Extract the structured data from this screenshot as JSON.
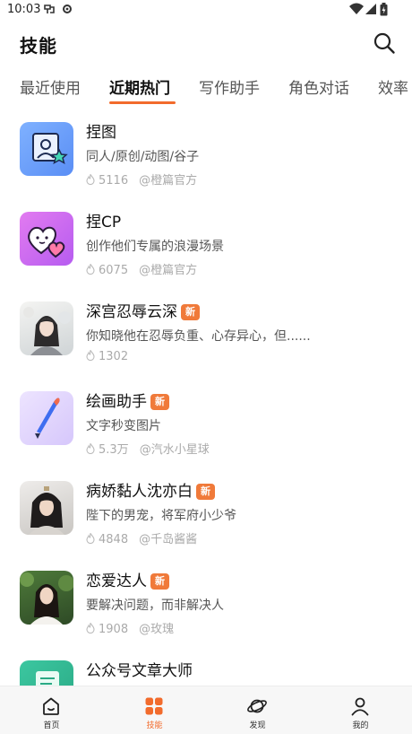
{
  "status_bar": {
    "time": "10:03"
  },
  "header": {
    "title": "技能"
  },
  "tabs": [
    {
      "label": "最近使用",
      "active": false
    },
    {
      "label": "近期热门",
      "active": true
    },
    {
      "label": "写作助手",
      "active": false
    },
    {
      "label": "角色对话",
      "active": false
    },
    {
      "label": "效率",
      "active": false
    }
  ],
  "skills": [
    {
      "name": "捏图",
      "badge": "",
      "desc": "同人/原创/动图/谷子",
      "heat": "5116",
      "author": "@橙篇官方",
      "icon": "photo-edit-icon"
    },
    {
      "name": "捏CP",
      "badge": "",
      "desc": "创作他们专属的浪漫场景",
      "heat": "6075",
      "author": "@橙篇官方",
      "icon": "hearts-icon"
    },
    {
      "name": "深宫忍辱云深",
      "badge": "新",
      "desc": "你知晓他在忍辱负重、心存异心，但......",
      "heat": "1302",
      "author": "",
      "icon": "character-portrait"
    },
    {
      "name": "绘画助手",
      "badge": "新",
      "desc": "文字秒变图片",
      "heat": "5.3万",
      "author": "@汽水小星球",
      "icon": "paint-brush-icon"
    },
    {
      "name": "病娇黏人沈亦白",
      "badge": "新",
      "desc": "陛下的男宠，将军府小少爷",
      "heat": "4848",
      "author": "@千岛酱酱",
      "icon": "character-portrait"
    },
    {
      "name": "恋爱达人",
      "badge": "新",
      "desc": "要解决问题，而非解决人",
      "heat": "1908",
      "author": "@玫瑰",
      "icon": "character-portrait"
    },
    {
      "name": "公众号文章大师",
      "badge": "",
      "desc": "",
      "heat": "",
      "author": "",
      "icon": "article-icon"
    }
  ],
  "bottom_nav": [
    {
      "label": "首页",
      "icon": "home-icon",
      "active": false
    },
    {
      "label": "技能",
      "icon": "grid-icon",
      "active": true
    },
    {
      "label": "发现",
      "icon": "planet-icon",
      "active": false
    },
    {
      "label": "我的",
      "icon": "person-icon",
      "active": false
    }
  ],
  "colors": {
    "accent": "#f26b2c",
    "badge": "#f07a3a"
  }
}
